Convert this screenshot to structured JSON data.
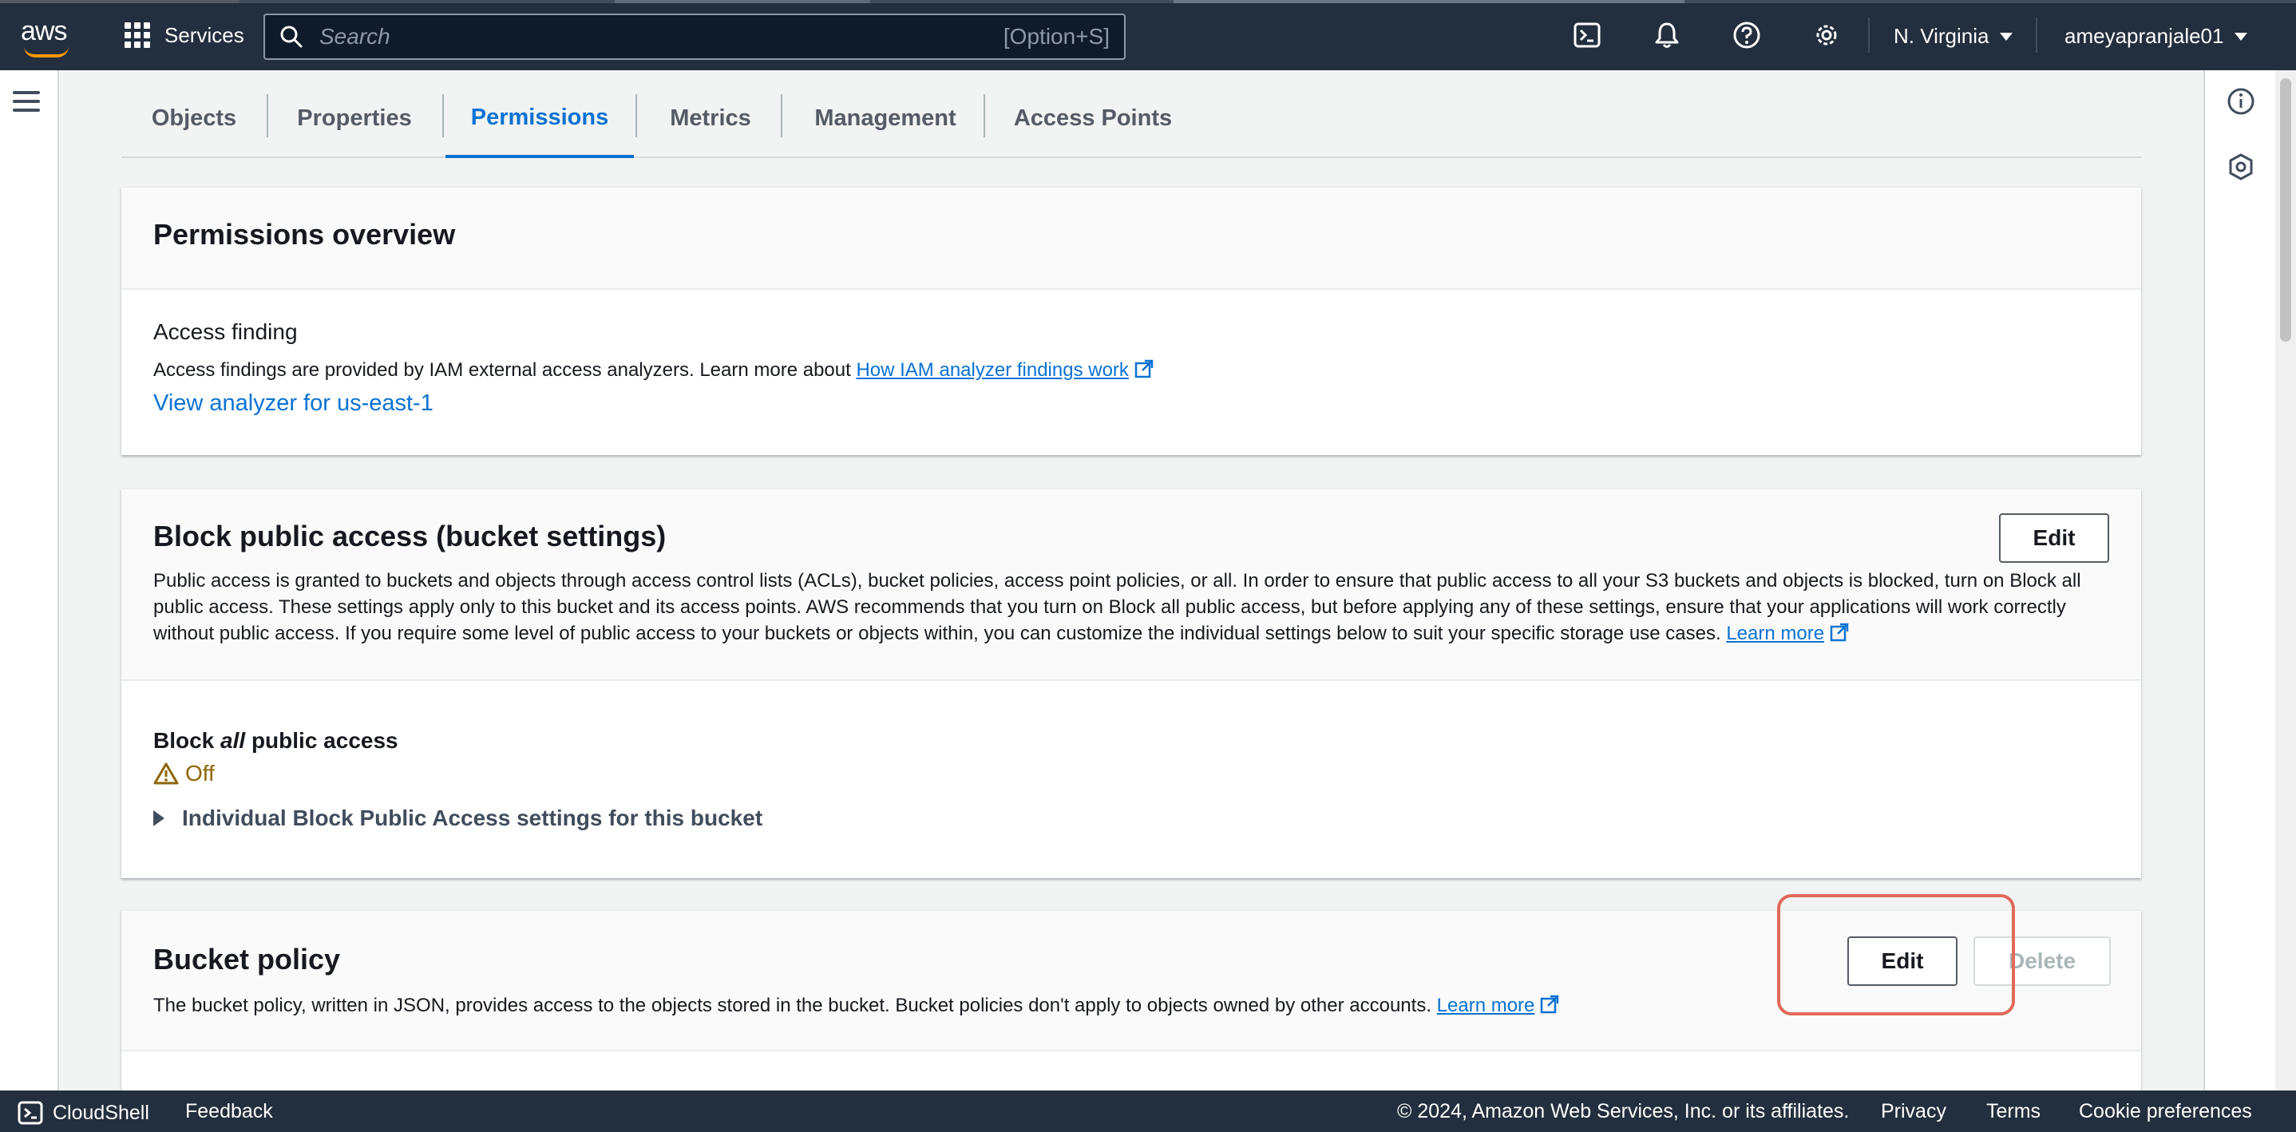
{
  "topnav": {
    "logo_text": "aws",
    "services_label": "Services",
    "search_placeholder": "Search",
    "search_shortcut": "[Option+S]",
    "region": "N. Virginia",
    "account": "ameyapranjale01",
    "icons": [
      "cloudshell-icon",
      "bell-icon",
      "help-icon",
      "settings-icon"
    ]
  },
  "tabs": [
    {
      "label": "Objects"
    },
    {
      "label": "Properties"
    },
    {
      "label": "Permissions",
      "active": true
    },
    {
      "label": "Metrics"
    },
    {
      "label": "Management"
    },
    {
      "label": "Access Points"
    }
  ],
  "permissions_overview": {
    "title": "Permissions overview",
    "access_finding_label": "Access finding",
    "description": "Access findings are provided by IAM external access analyzers. Learn more about ",
    "description_link": "How IAM analyzer findings work",
    "analyzer_link": "View analyzer for us-east-1"
  },
  "block_public_access": {
    "title": "Block public access (bucket settings)",
    "edit_label": "Edit",
    "description": "Public access is granted to buckets and objects through access control lists (ACLs), bucket policies, access point policies, or all. In order to ensure that public access to all your S3 buckets and objects is blocked, turn on Block all public access. These settings apply only to this bucket and its access points. AWS recommends that you turn on Block all public access, but before applying any of these settings, ensure that your applications will work correctly without public access. If you require some level of public access to your buckets or objects within, you can customize the individual settings below to suit your specific storage use cases.",
    "learn_more": "Learn more",
    "setting_label_prefix": "Block ",
    "setting_label_emphasis": "all",
    "setting_label_suffix": " public access",
    "status": "Off",
    "expander_label": "Individual Block Public Access settings for this bucket"
  },
  "bucket_policy": {
    "title": "Bucket policy",
    "edit_label": "Edit",
    "delete_label": "Delete",
    "description": "The bucket policy, written in JSON, provides access to the objects stored in the bucket. Bucket policies don't apply to objects owned by other accounts.",
    "learn_more": "Learn more"
  },
  "footer": {
    "cloudshell": "CloudShell",
    "feedback": "Feedback",
    "copyright": "© 2024, Amazon Web Services, Inc. or its affiliates.",
    "privacy": "Privacy",
    "terms": "Terms",
    "cookies": "Cookie preferences"
  },
  "colors": {
    "nav_bg": "#232f3e",
    "link": "#0972d3",
    "warning": "#8d6605",
    "highlight": "#e0695a"
  }
}
